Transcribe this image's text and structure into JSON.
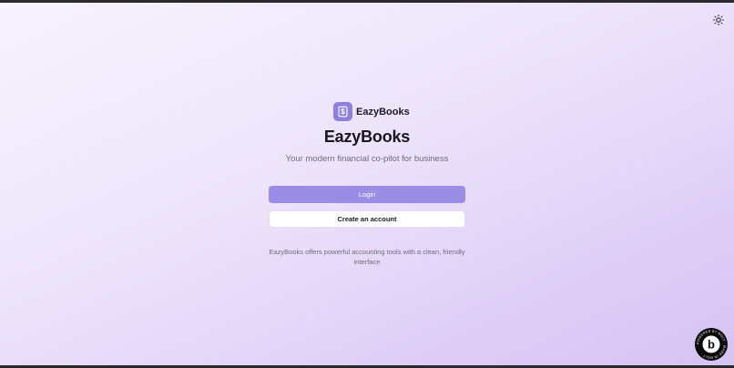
{
  "app": {
    "brand_name": "EazyBooks",
    "title": "EazyBooks",
    "subtitle": "Your modern financial co-pilot for business"
  },
  "actions": {
    "login_label": "Login",
    "create_account_label": "Create an account"
  },
  "footnote": "EazyBooks offers powerful accounting tools with a clean, friendly interface",
  "icons": {
    "theme_toggle": "sun-icon",
    "logo": "dollar-document-icon",
    "badge": "bolt-badge-icon"
  },
  "badge": {
    "ring_text": "POWERED BY BOLT · MADE IN BOLT ·",
    "letter": "b"
  },
  "colors": {
    "accent": "#9b8ce6",
    "logo_bg": "#8d7fdb",
    "background_start": "#f7f3fd",
    "background_end": "#d5c3f2"
  }
}
